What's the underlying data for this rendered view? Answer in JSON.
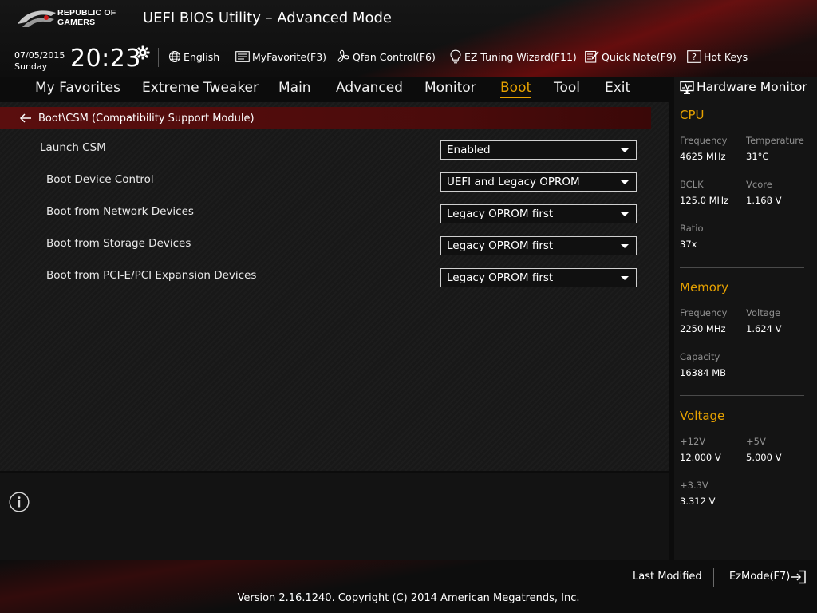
{
  "header": {
    "logo_text_line1": "REPUBLIC OF",
    "logo_text_line2": "GAMERS",
    "title": "UEFI BIOS Utility – Advanced Mode",
    "date": "07/05/2015",
    "day": "Sunday",
    "time": "20:23",
    "toolbar": [
      {
        "label": "English",
        "icon": "globe-icon"
      },
      {
        "label": "MyFavorite(F3)",
        "icon": "favorite-icon"
      },
      {
        "label": "Qfan Control(F6)",
        "icon": "fan-icon"
      },
      {
        "label": "EZ Tuning Wizard(F11)",
        "icon": "lightbulb-icon"
      },
      {
        "label": "Quick Note(F9)",
        "icon": "note-icon"
      },
      {
        "label": "Hot Keys",
        "icon": "help-icon"
      }
    ]
  },
  "nav": {
    "tabs": [
      "My Favorites",
      "Extreme Tweaker",
      "Main",
      "Advanced",
      "Monitor",
      "Boot",
      "Tool",
      "Exit"
    ],
    "active": "Boot"
  },
  "main": {
    "breadcrumb": "Boot\\CSM (Compatibility Support Module)",
    "settings": [
      {
        "label": "Launch CSM",
        "value": "Enabled"
      },
      {
        "label": "Boot Device Control",
        "value": "UEFI and Legacy OPROM"
      },
      {
        "label": "Boot from Network Devices",
        "value": "Legacy OPROM first"
      },
      {
        "label": "Boot from Storage Devices",
        "value": "Legacy OPROM first"
      },
      {
        "label": "Boot from PCI-E/PCI Expansion Devices",
        "value": "Legacy OPROM first"
      }
    ]
  },
  "hardware_monitor": {
    "title": "Hardware Monitor",
    "cpu": {
      "section": "CPU",
      "frequency_label": "Frequency",
      "frequency": "4625 MHz",
      "temperature_label": "Temperature",
      "temperature": "31°C",
      "bclk_label": "BCLK",
      "bclk": "125.0 MHz",
      "vcore_label": "Vcore",
      "vcore": "1.168 V",
      "ratio_label": "Ratio",
      "ratio": "37x"
    },
    "memory": {
      "section": "Memory",
      "frequency_label": "Frequency",
      "frequency": "2250 MHz",
      "voltage_label": "Voltage",
      "voltage": "1.624 V",
      "capacity_label": "Capacity",
      "capacity": "16384 MB"
    },
    "voltage": {
      "section": "Voltage",
      "v12_label": "+12V",
      "v12": "12.000 V",
      "v5_label": "+5V",
      "v5": "5.000 V",
      "v33_label": "+3.3V",
      "v33": "3.312 V"
    }
  },
  "footer": {
    "last_modified": "Last Modified",
    "ezmode": "EzMode(F7)",
    "version": "Version 2.16.1240. Copyright (C) 2014 American Megatrends, Inc."
  },
  "colors": {
    "accent": "#e6a100",
    "breadcrumb_bar": "#5a0e0e",
    "panel_bg": "#141414"
  }
}
